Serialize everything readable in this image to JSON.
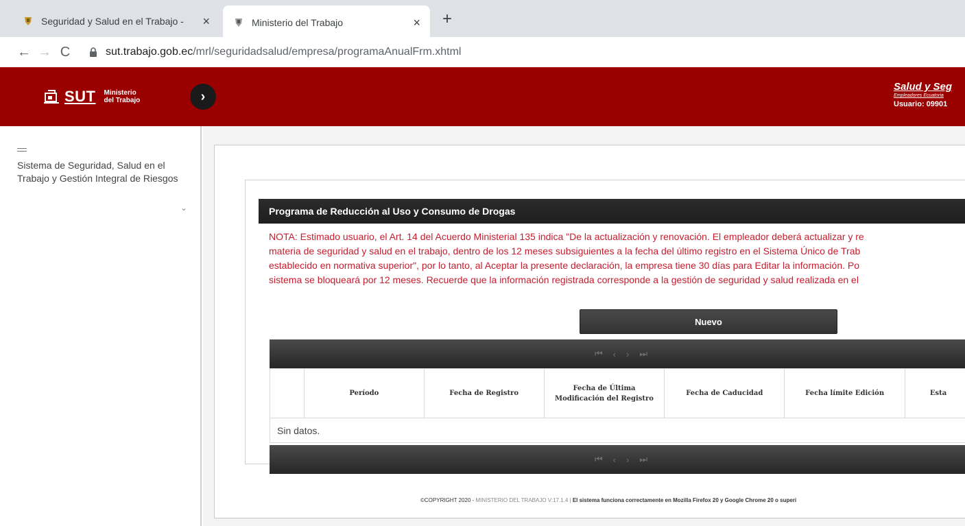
{
  "browser": {
    "tabs": [
      {
        "title": "Seguridad y Salud en el Trabajo -",
        "active": false
      },
      {
        "title": "Ministerio del Trabajo",
        "active": true
      }
    ],
    "close_glyph": "×",
    "new_tab_glyph": "+",
    "back_glyph": "←",
    "forward_glyph": "→",
    "reload_glyph": "C",
    "url_host": "sut.trabajo.gob.ec",
    "url_path": "/mrl/seguridadsalud/empresa/programaAnualFrm.xhtml"
  },
  "header": {
    "logo_text": "SUT",
    "logo_ministry_line1": "Ministerio",
    "logo_ministry_line2": "del Trabajo",
    "toggle_glyph": "›",
    "right_title": "Salud y Seg",
    "right_subtitle": "Empleadores Ecuatoria",
    "right_user": "Usuario: 09901",
    "bg_color": "#9b0000"
  },
  "sidebar": {
    "menu_label": "Sistema de Seguridad, Salud en el Trabajo y Gestión Integral de Riesgos",
    "chevron": "⌄"
  },
  "panel": {
    "title": "Programa de Reducción al Uso y Consumo de Drogas",
    "nota_lines": [
      "NOTA: Estimado usuario, el Art. 14 del Acuerdo Ministerial 135 indica \"De la actualización y renovación. El empleador deberá actualizar y re",
      "materia de seguridad y salud en el trabajo, dentro de los 12 meses subsiguientes a la fecha del último registro en el Sistema Único de Trab",
      "establecido en normativa superior\", por lo tanto, al Aceptar la presente declaración, la empresa tiene 30 días para Editar la información. Po",
      "sistema se bloqueará por 12 meses. Recuerde que la información registrada corresponde a la gestión de seguridad y salud realizada en el"
    ],
    "new_button": "Nuevo"
  },
  "pager": {
    "first": "⏮",
    "prev": "‹",
    "next": "›",
    "last": "⏭"
  },
  "table": {
    "headers": [
      "",
      "Período",
      "Fecha de Registro",
      "Fecha de Última Modificación del Registro",
      "Fecha de Caducidad",
      "Fecha límite Edición",
      "Esta"
    ],
    "empty_message": "Sin datos."
  },
  "footer": {
    "left": "©COPYRIGHT 2020 - ",
    "middle": "MINISTERIO DEL TRABAJO V:17.1.4 | ",
    "right": "El sistema funciona correctamente en Mozilla Firefox 20 y Google Chrome 20 o superi"
  }
}
